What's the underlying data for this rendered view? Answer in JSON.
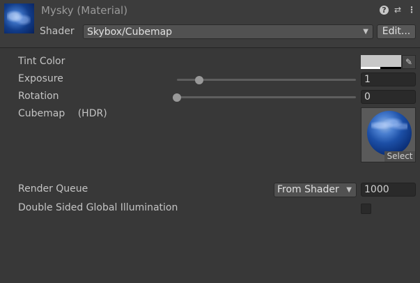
{
  "header": {
    "title": "Mysky (Material)",
    "shader_label": "Shader",
    "shader_value": "Skybox/Cubemap",
    "edit_button": "Edit...",
    "icons": [
      "help-icon",
      "preset-icon",
      "kebab-menu-icon"
    ]
  },
  "properties": {
    "tint_color": {
      "label": "Tint Color",
      "color": "#c7c7c7"
    },
    "exposure": {
      "label": "Exposure",
      "value": "1",
      "slider_fraction": 0.125
    },
    "rotation": {
      "label": "Rotation",
      "value": "0",
      "slider_fraction": 0.0
    },
    "cubemap": {
      "label": "Cubemap",
      "suffix": "(HDR)",
      "select_label": "Select"
    },
    "render_queue": {
      "label": "Render Queue",
      "mode": "From Shader",
      "value": "1000"
    },
    "double_sided_gi": {
      "label": "Double Sided Global Illumination",
      "checked": false
    }
  }
}
